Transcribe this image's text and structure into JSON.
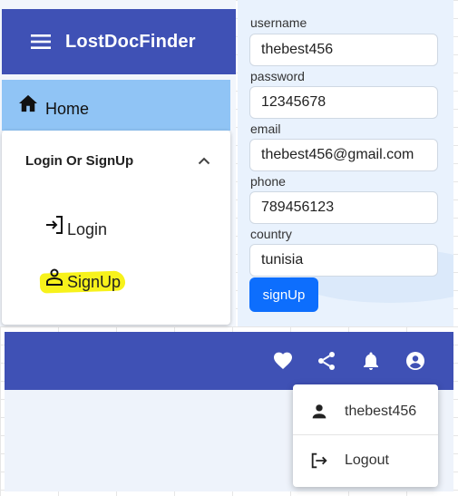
{
  "app": {
    "title": "LostDocFinder"
  },
  "drawer": {
    "home_label": "Home",
    "section": {
      "title": "Login Or SignUp",
      "items": [
        {
          "label": "Login",
          "icon": "login-icon"
        },
        {
          "label": "SignUp",
          "icon": "person-outline-icon",
          "highlighted": true
        }
      ]
    }
  },
  "form": {
    "fields": [
      {
        "label": "username",
        "value": "thebest456"
      },
      {
        "label": "password",
        "value": "12345678"
      },
      {
        "label": "email",
        "value": "thebest456@gmail.com"
      },
      {
        "label": "phone",
        "value": "789456123"
      },
      {
        "label": "country",
        "value": "tunisia"
      }
    ],
    "submit_label": "signUp"
  },
  "toolbar": {
    "icons": [
      "heart-icon",
      "share-icon",
      "bell-icon",
      "account-circle-icon"
    ]
  },
  "account_menu": {
    "username": "thebest456",
    "logout_label": "Logout"
  },
  "colors": {
    "primary": "#3f51b5",
    "nav_selected": "#90c4f5",
    "button": "#0d6efd",
    "highlight": "#f7f21b"
  }
}
